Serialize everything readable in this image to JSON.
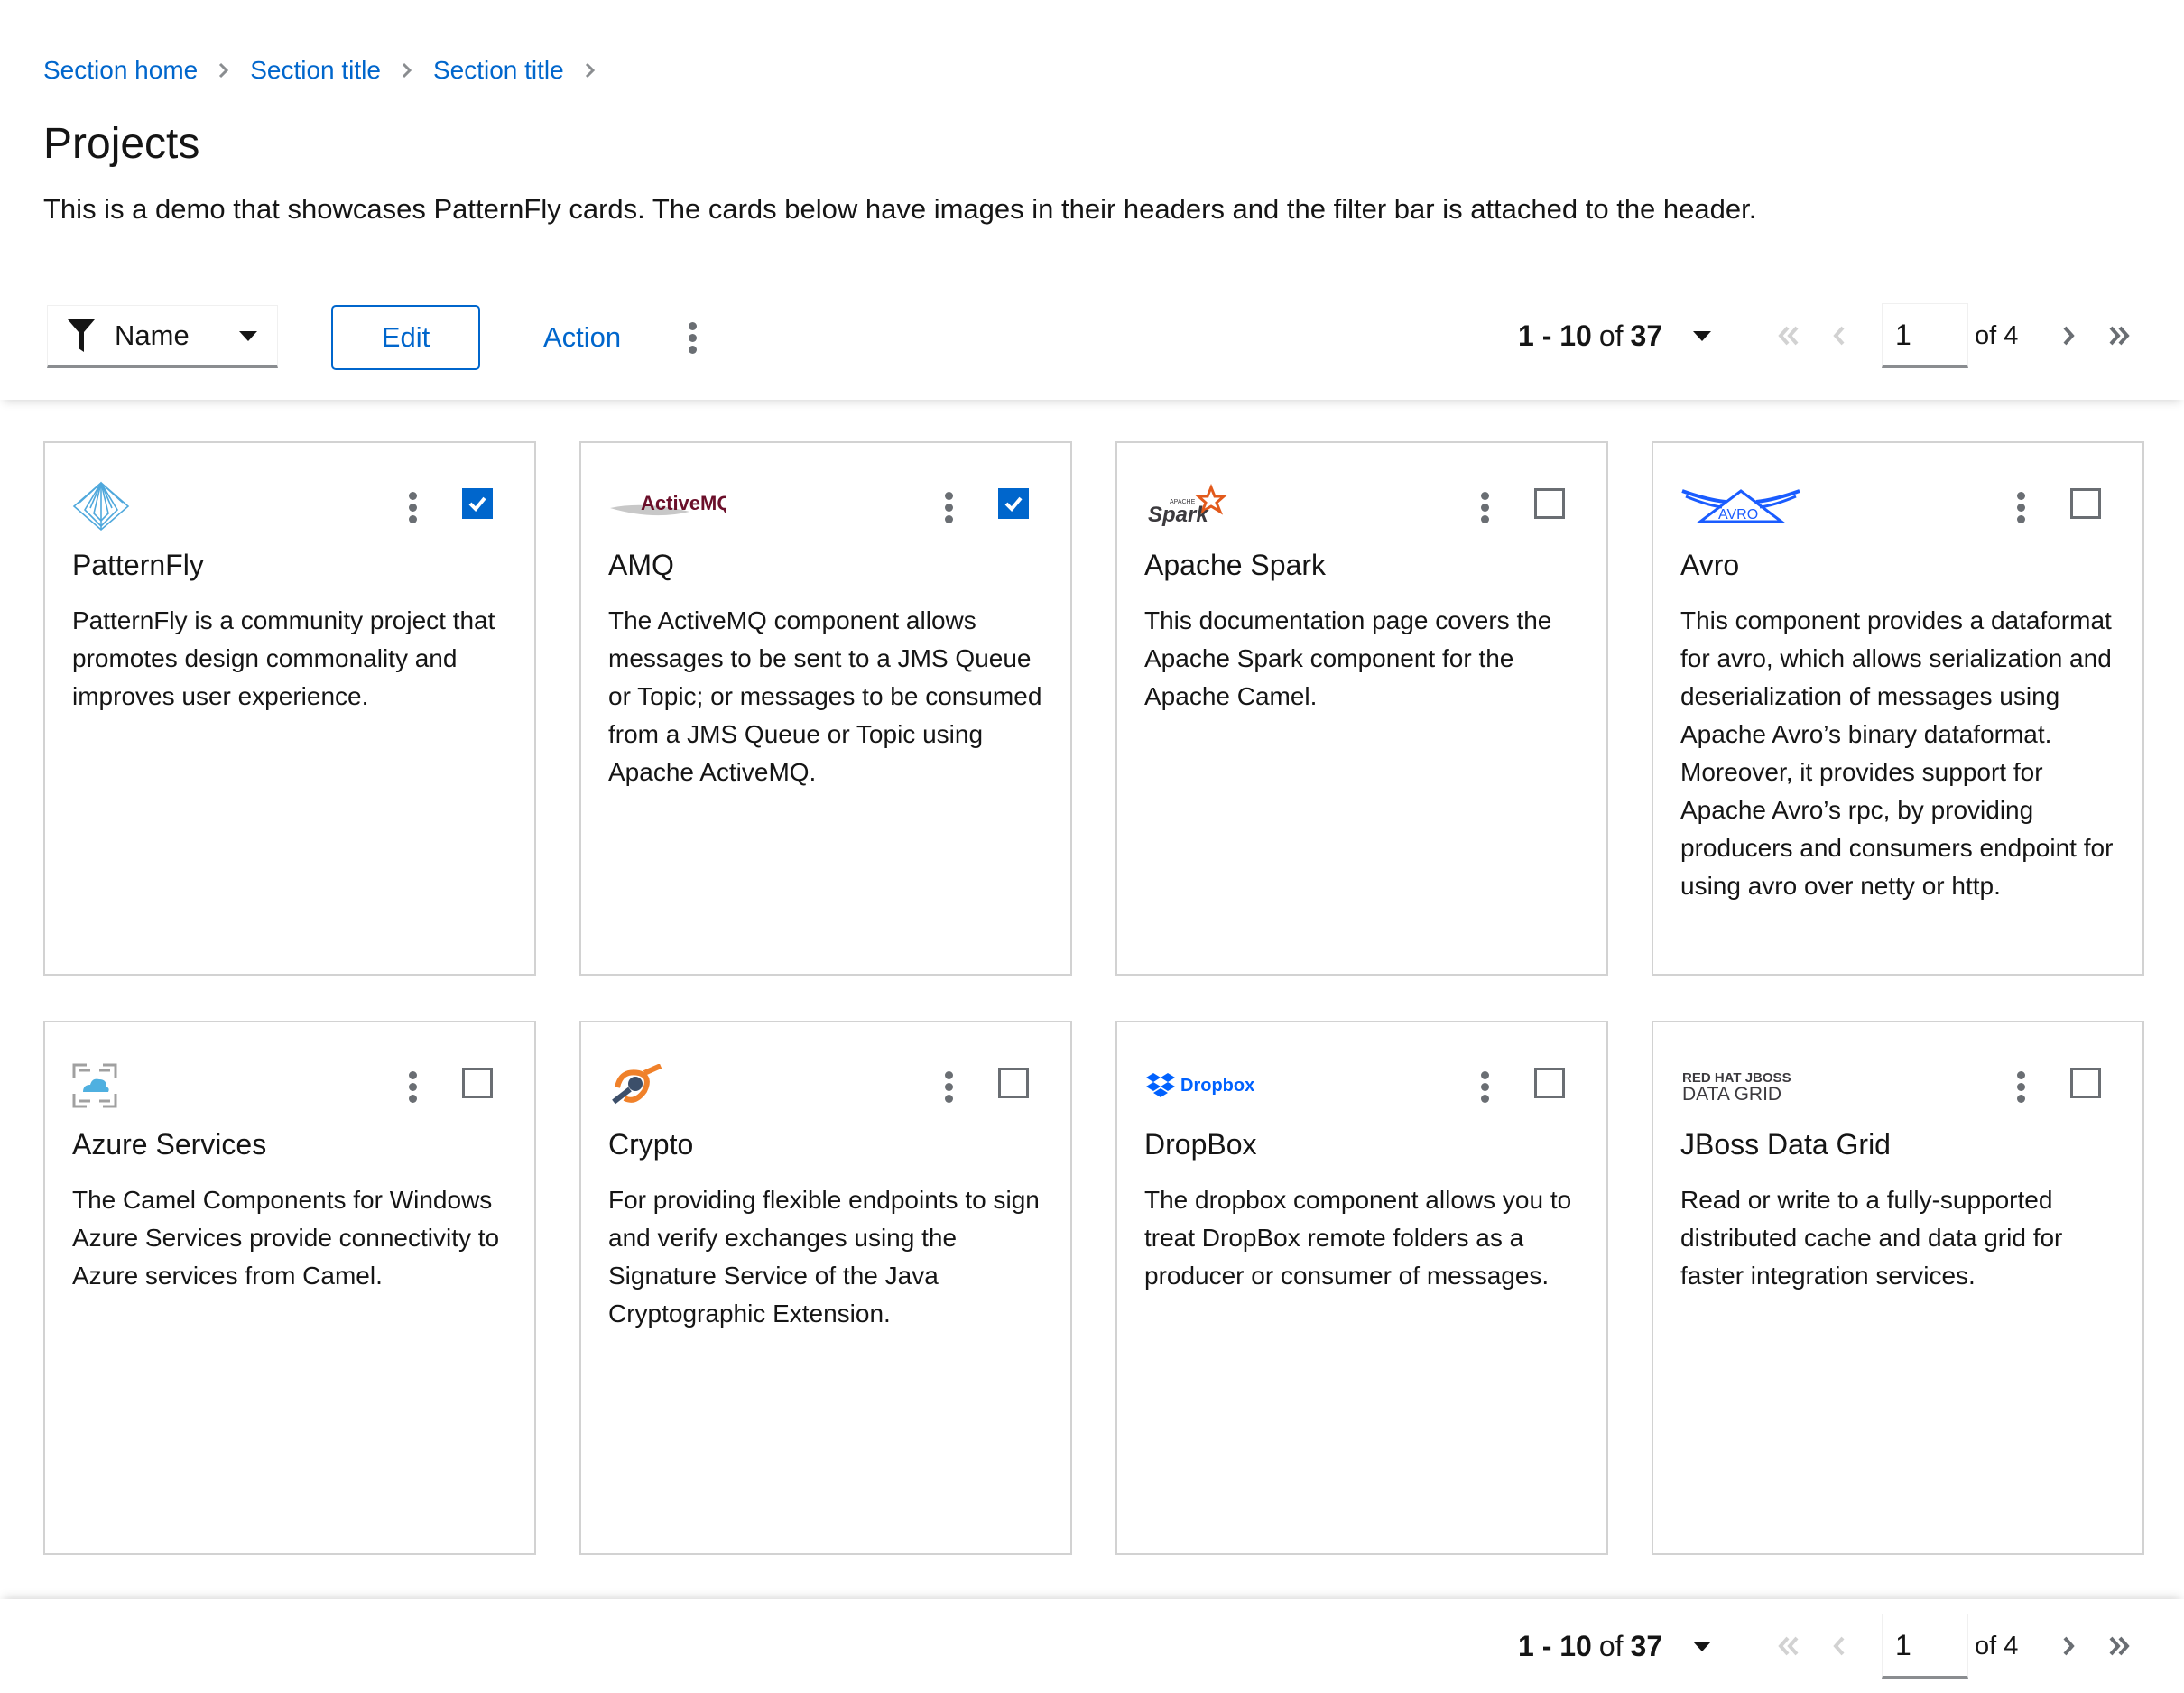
{
  "breadcrumb": [
    {
      "label": "Section home"
    },
    {
      "label": "Section title"
    },
    {
      "label": "Section title"
    }
  ],
  "page": {
    "title": "Projects",
    "description": "This is a demo that showcases PatternFly cards. The cards below have images in their headers and the filter bar is attached to the header."
  },
  "toolbar": {
    "filter_label": "Name",
    "edit_label": "Edit",
    "action_label": "Action"
  },
  "pagination": {
    "range": "1 - 10",
    "of_text": "of",
    "total": "37",
    "page_value": "1",
    "page_of": "of 4"
  },
  "colors": {
    "accent": "#0066cc",
    "border": "#d2d2d2",
    "text": "#151515",
    "icon_gray": "#6a6e73"
  },
  "cards": [
    {
      "title": "PatternFly",
      "logo": "patternfly-logo",
      "checked": true,
      "body": "PatternFly is a community project that promotes design commonality and improves user experience."
    },
    {
      "title": "AMQ",
      "logo": "activemq-logo",
      "logo_text": "ActiveMQ",
      "checked": true,
      "body": "The ActiveMQ component allows messages to be sent to a JMS Queue or Topic; or messages to be consumed from a JMS Queue or Topic using Apache ActiveMQ."
    },
    {
      "title": "Apache Spark",
      "logo": "spark-logo",
      "logo_text": "Spark",
      "logo_subtext": "APACHE",
      "checked": false,
      "body": "This documentation page covers the Apache Spark component for the Apache Camel."
    },
    {
      "title": "Avro",
      "logo": "avro-logo",
      "logo_text": "AVRO",
      "checked": false,
      "body": "This component provides a dataformat for avro, which allows serialization and deserialization of messages using Apache Avro’s binary dataformat. Moreover, it provides support for Apache Avro’s rpc, by providing producers and consumers endpoint for using avro over netty or http."
    },
    {
      "title": "Azure Services",
      "logo": "azure-logo",
      "checked": false,
      "body": "The Camel Components for Windows Azure Services provide connectivity to Azure services from Camel."
    },
    {
      "title": "Crypto",
      "logo": "crypto-logo",
      "checked": false,
      "body": "For providing flexible endpoints to sign and verify exchanges using the Signature Service of the Java Cryptographic Extension."
    },
    {
      "title": "DropBox",
      "logo": "dropbox-logo",
      "logo_text": "Dropbox",
      "checked": false,
      "body": "The dropbox component allows you to treat DropBox remote folders as a producer or consumer of messages."
    },
    {
      "title": "JBoss Data Grid",
      "logo": "jboss-data-grid-logo",
      "logo_text": "RED HAT JBOSS",
      "logo_subtext": "DATA GRID",
      "checked": false,
      "body": "Read or write to a fully-supported distributed cache and data grid for faster integration services."
    }
  ]
}
